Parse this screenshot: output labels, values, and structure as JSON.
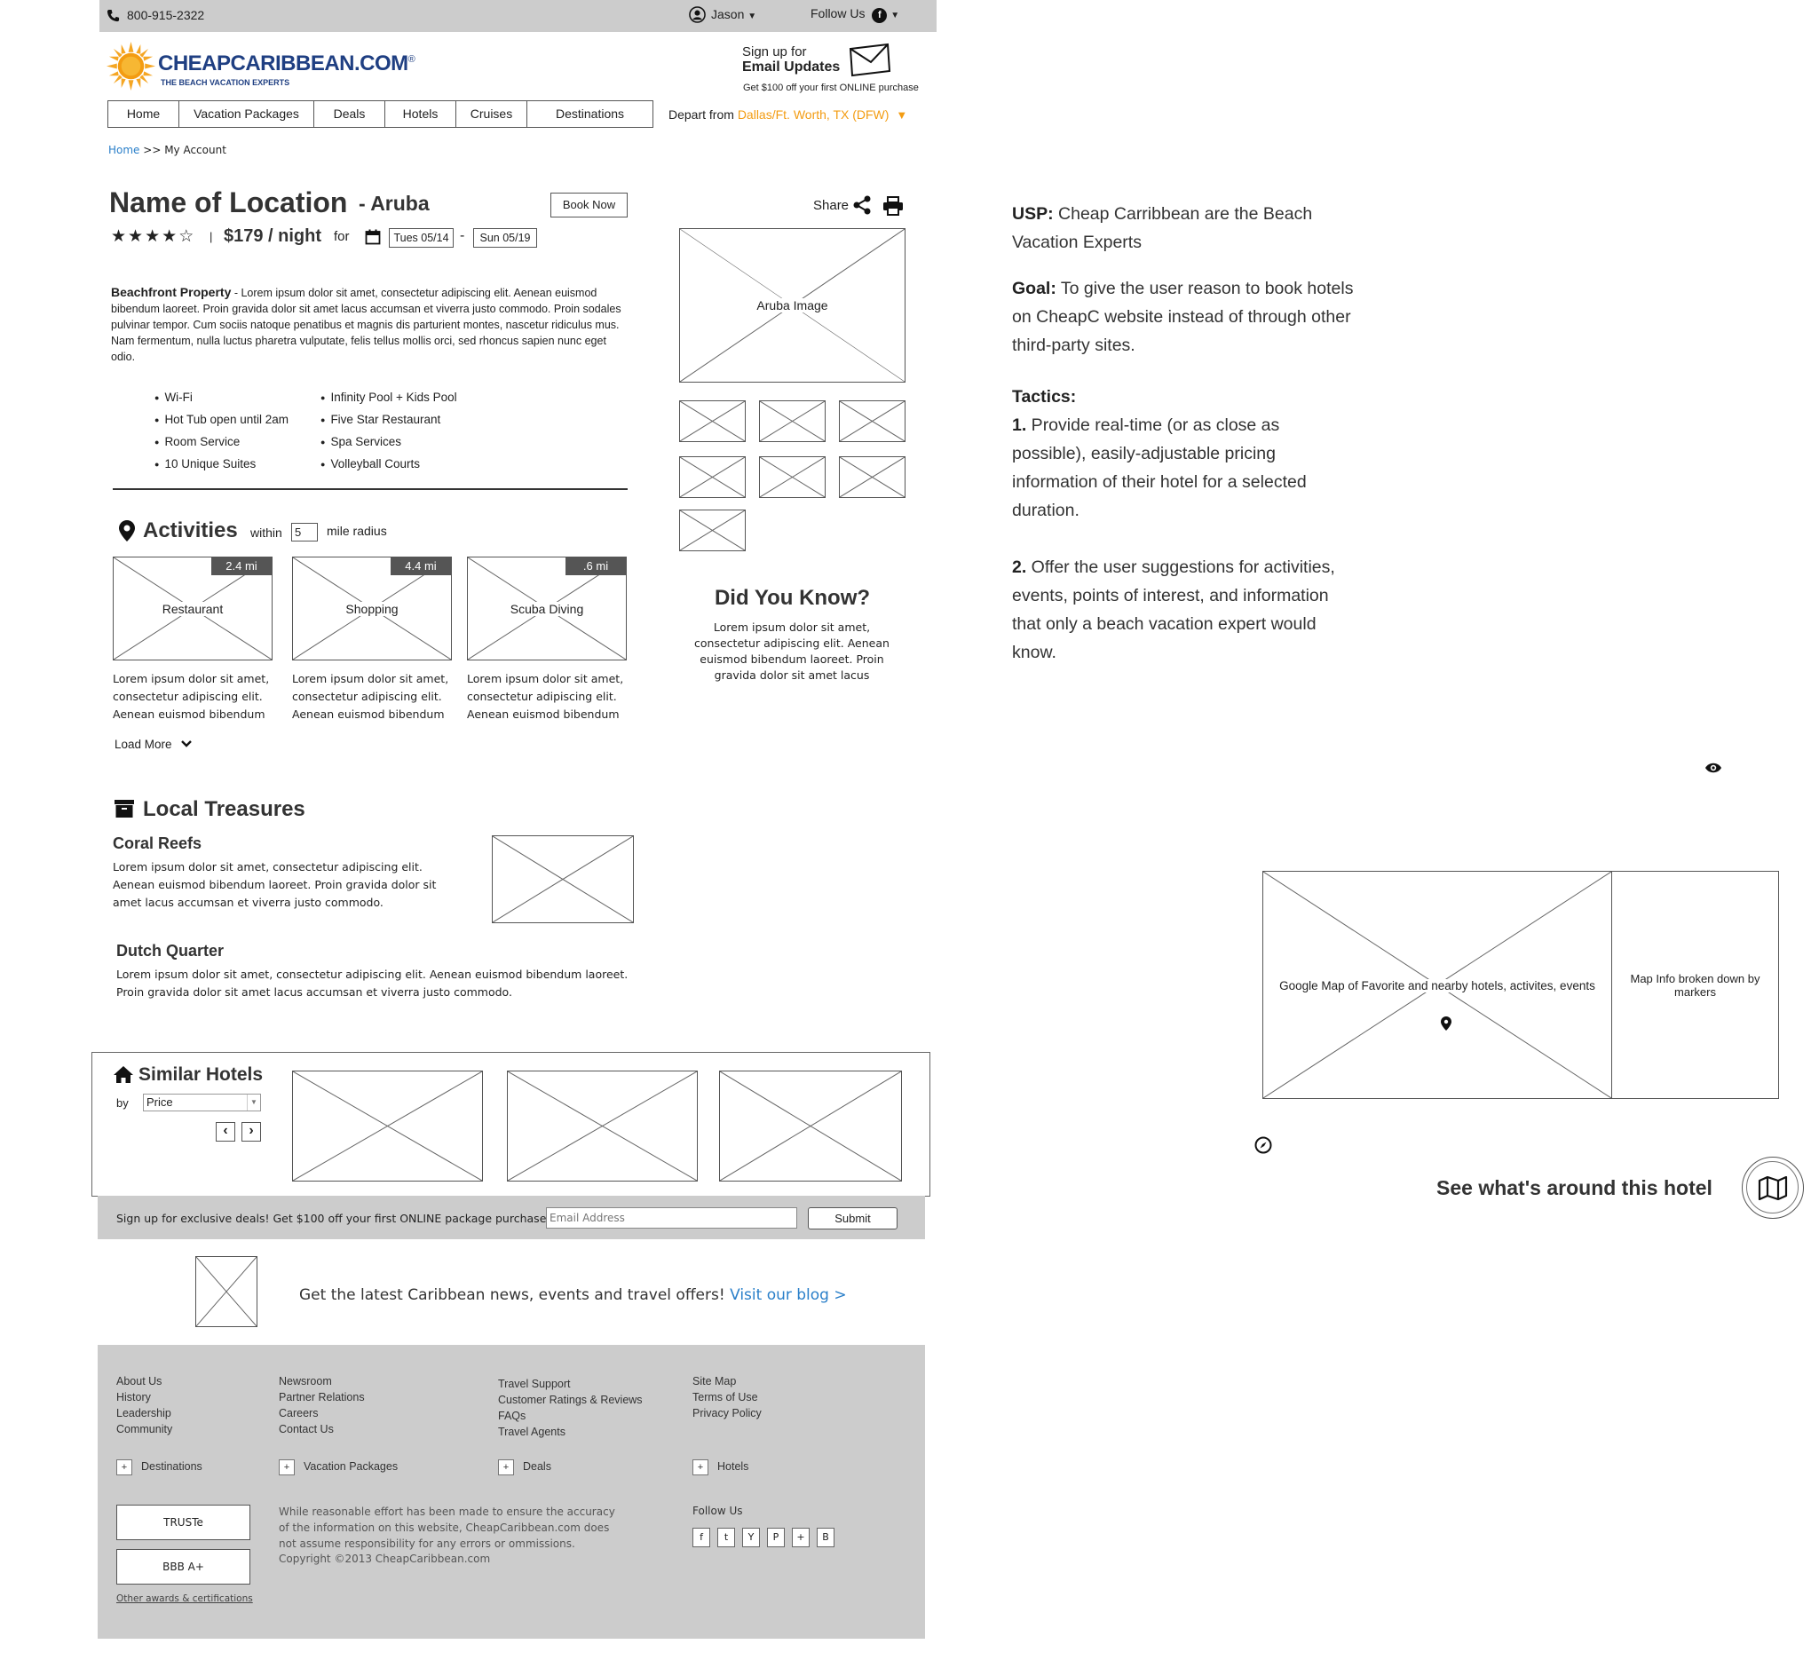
{
  "topbar": {
    "phone": "800-915-2322",
    "user": "Jason",
    "follow": "Follow Us"
  },
  "brand": {
    "name": "CHEAPCARIBBEAN.COM",
    "reg": "®",
    "tagline": "THE BEACH VACATION EXPERTS"
  },
  "email_signup": {
    "line1": "Sign up for",
    "line2": "Email Updates",
    "offer": "Get $100 off your first ONLINE purchase"
  },
  "nav": [
    "Home",
    "Vacation Packages",
    "Deals",
    "Hotels",
    "Cruises",
    "Destinations"
  ],
  "depart": {
    "label": "Depart from",
    "value": "Dallas/Ft. Worth, TX (DFW)"
  },
  "breadcrumb": {
    "home": "Home",
    "rest": ">> My Account"
  },
  "hotel": {
    "title": "Name of Location",
    "location": "- Aruba",
    "book_label": "Book Now",
    "rating": 4,
    "rating_max": 5,
    "price": "$179 / night",
    "for": "for",
    "date_from": "Tues 05/14",
    "date_sep": "-",
    "date_to": "Sun 05/19",
    "desc_bold": "Beachfront Property",
    "desc": " - Lorem ipsum dolor sit amet, consectetur adipiscing elit. Aenean euismod bibendum laoreet. Proin gravida dolor sit amet lacus accumsan et viverra justo commodo. Proin sodales pulvinar tempor. Cum sociis natoque penatibus et magnis dis parturient montes, nascetur ridiculus mus. Nam fermentum, nulla luctus pharetra vulputate, felis tellus mollis orci, sed rhoncus sapien nunc eget odio.",
    "amenities_left": [
      "Wi-Fi",
      "Hot Tub open until 2am",
      "Room Service",
      "10 Unique Suites"
    ],
    "amenities_right": [
      "Infinity Pool + Kids Pool",
      "Five Star Restaurant",
      "Spa Services",
      "Volleyball Courts"
    ]
  },
  "share": {
    "label": "Share"
  },
  "gallery": {
    "main_label": "Aruba Image"
  },
  "did_you_know": {
    "title": "Did You Know?",
    "text": "Lorem ipsum dolor sit amet, consectetur adipiscing elit. Aenean euismod bibendum laoreet. Proin gravida dolor sit amet lacus"
  },
  "activities": {
    "title": "Activities",
    "within": "within",
    "radius": "5",
    "unit": "mile radius",
    "items": [
      {
        "label": "Restaurant",
        "distance": "2.4 mi",
        "text": "Lorem ipsum dolor sit amet, consectetur adipiscing elit. Aenean euismod bibendum"
      },
      {
        "label": "Shopping",
        "distance": "4.4 mi",
        "text": "Lorem ipsum dolor sit amet, consectetur adipiscing elit. Aenean euismod bibendum"
      },
      {
        "label": "Scuba Diving",
        "distance": ".6 mi",
        "text": "Lorem ipsum dolor sit amet, consectetur adipiscing elit. Aenean euismod bibendum"
      }
    ],
    "load_more": "Load More"
  },
  "treasures": {
    "title": "Local Treasures",
    "items": [
      {
        "title": "Coral Reefs",
        "text": "Lorem ipsum dolor sit amet, consectetur adipiscing elit. Aenean euismod bibendum laoreet. Proin gravida dolor sit amet lacus accumsan et viverra justo commodo."
      },
      {
        "title": "Dutch Quarter",
        "text": "Lorem ipsum dolor sit amet, consectetur adipiscing elit. Aenean euismod bibendum laoreet. Proin gravida dolor sit amet lacus accumsan et viverra justo commodo."
      }
    ]
  },
  "similar": {
    "title": "Similar Hotels",
    "by": "by",
    "sort_value": "Price"
  },
  "deals": {
    "text": "Sign up for exclusive deals! Get $100 off your first ONLINE package purchase!",
    "placeholder": "Email Address",
    "submit": "Submit"
  },
  "blog": {
    "text": "Get the latest Caribbean news, events and travel offers!",
    "link": "Visit our blog >"
  },
  "footer": {
    "col1": [
      "About Us",
      "History",
      "Leadership",
      "Community"
    ],
    "col2": [
      "Newsroom",
      "Partner Relations",
      "Careers",
      "Contact Us"
    ],
    "col3": [
      "Travel Support",
      "Customer Ratings & Reviews",
      "FAQs",
      "Travel Agents"
    ],
    "col4": [
      "Site Map",
      "Terms of Use",
      "Privacy Policy"
    ],
    "expanders": [
      "Destinations",
      "Vacation Packages",
      "Deals",
      "Hotels"
    ],
    "badges": [
      "TRUSTe",
      "BBB A+"
    ],
    "awards_link": "Other awards & certifications",
    "disclaimer": "While reasonable effort has been made to ensure the accuracy of the information on this website, CheapCaribbean.com does not assume responsibility for any errors or ommissions.",
    "copyright": "Copyright ©2013 CheapCaribbean.com",
    "follow": "Follow Us",
    "social": [
      "f",
      "t",
      "Y",
      "P",
      "+",
      "B"
    ]
  },
  "notes": {
    "usp_label": "USP:",
    "usp": " Cheap Carribbean are the Beach Vacation Experts",
    "goal_label": "Goal:",
    "goal": " To give the user reason to book hotels on CheapC website instead of through other third-party sites.",
    "tactics_label": "Tactics:",
    "t1_num": "1.",
    "t1": " Provide real-time (or as close as possible), easily-adjustable pricing information of their hotel for a selected duration.",
    "t2_num": "2.",
    "t2": " Offer the user suggestions for activities, events, points of interest, and information that only a beach vacation expert would know."
  },
  "map": {
    "label": "Google Map of Favorite and nearby hotels, activites, events",
    "info": "Map Info broken down by markers",
    "cta": "See what's around this hotel"
  },
  "colors": {
    "accent_orange": "#f39c12",
    "link_blue": "#2a7fc9",
    "brand_navy": "#1f3f82",
    "footer_gray": "#cccccc"
  }
}
